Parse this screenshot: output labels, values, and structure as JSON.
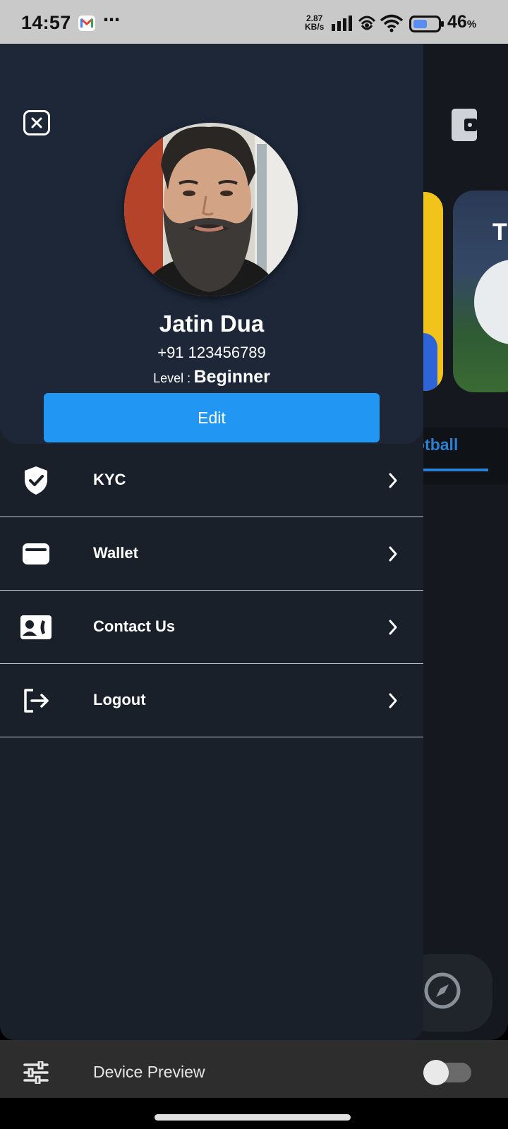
{
  "status_bar": {
    "time": "14:57",
    "net_speed_value": "2.87",
    "net_speed_unit": "KB/s",
    "more": "⋯",
    "battery_percent": "46",
    "battery_percent_sign": "%",
    "icons": [
      "gmail-icon",
      "signal-icon",
      "hotspot-icon",
      "wifi-icon",
      "battery-icon"
    ]
  },
  "background_app": {
    "card_text": "T",
    "tab_label": "otball",
    "tab_color": "#2d7fd1"
  },
  "profile": {
    "name": "Jatin Dua",
    "phone": "+91 123456789",
    "level_label": "Level :",
    "level_value": "Beginner",
    "edit_label": "Edit",
    "accent": "#2196f3"
  },
  "menu": {
    "items": [
      {
        "label": "KYC",
        "icon": "shield-check-icon"
      },
      {
        "label": "Wallet",
        "icon": "wallet-icon"
      },
      {
        "label": "Contact Us",
        "icon": "contact-card-icon"
      },
      {
        "label": "Logout",
        "icon": "logout-icon"
      }
    ]
  },
  "device_preview": {
    "label": "Device Preview",
    "enabled": false
  }
}
